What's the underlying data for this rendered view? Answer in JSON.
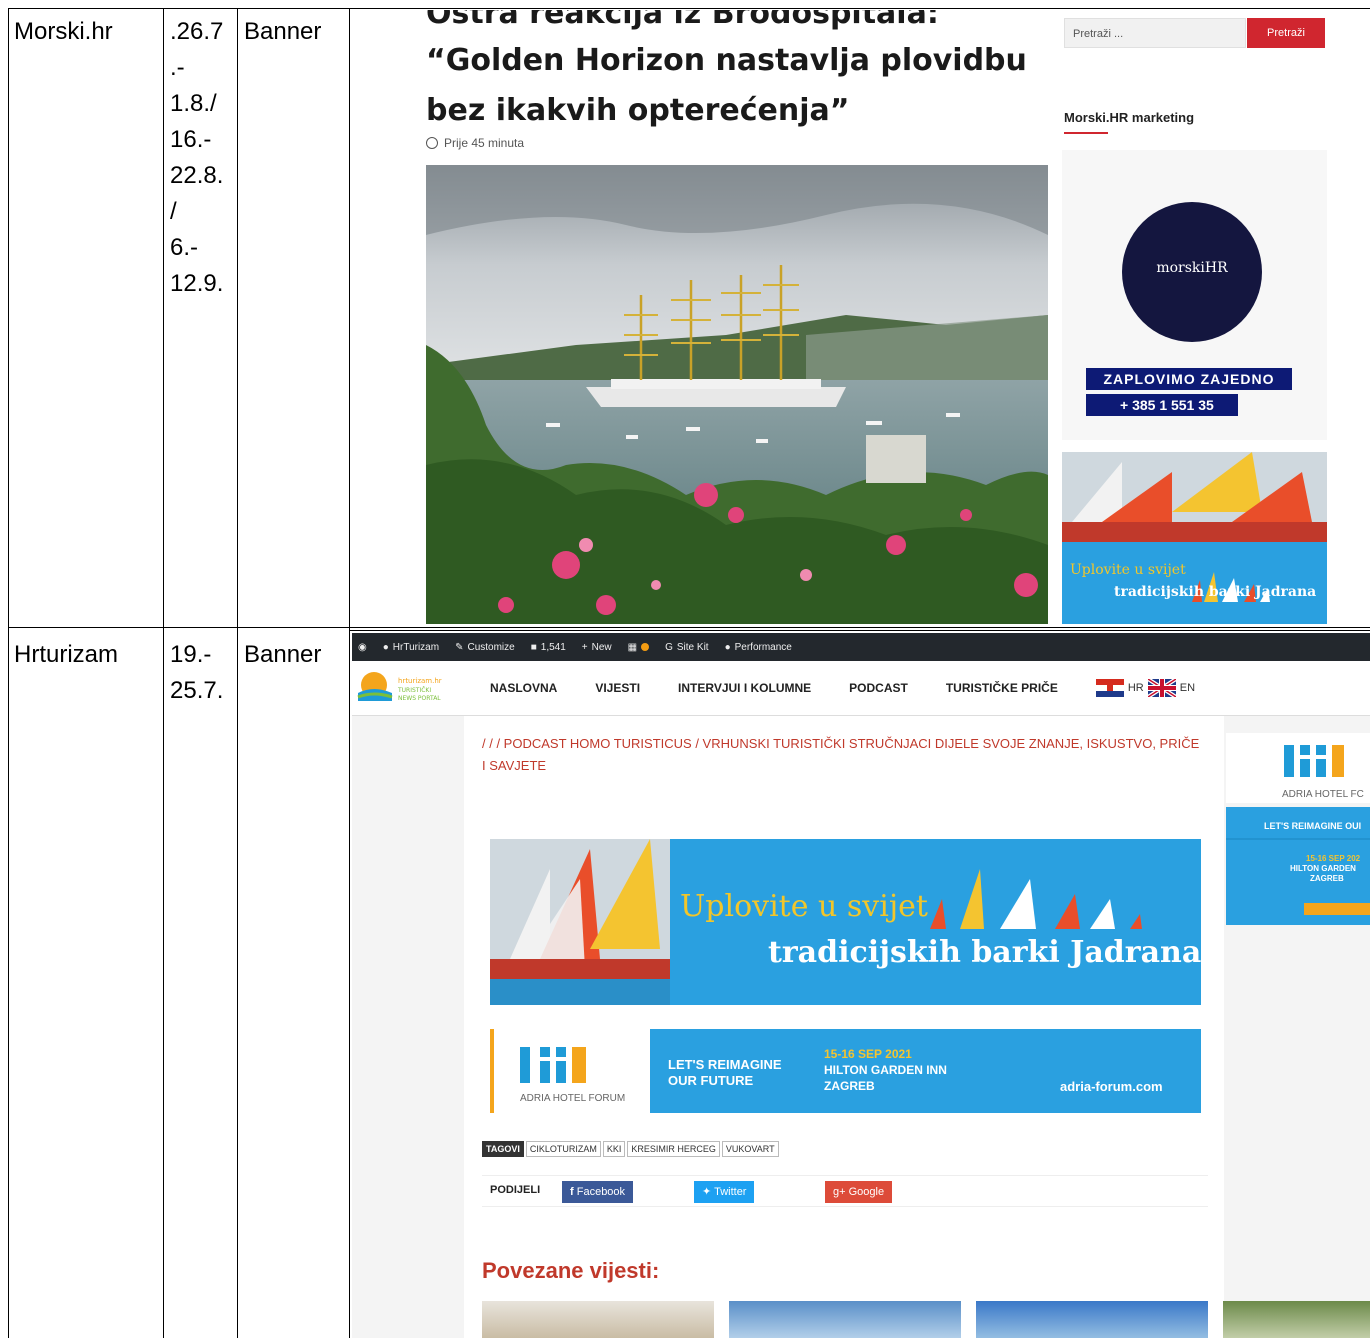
{
  "table": {
    "rows": [
      {
        "site": "Morski.hr",
        "dates": ".26.7\n.-\n1.8./\n16.-\n22.8.\n/\n6.-\n12.9.",
        "type": "Banner"
      },
      {
        "site": "Hrturizam",
        "dates": "19.-\n25.7.",
        "type": "Banner"
      }
    ]
  },
  "morski": {
    "headline_cut": "Ostra reakcija iz Brodospitala:",
    "headline": "“Golden Horizon nastavlja plovidbu bez ikakvih opterećenja”",
    "time_ago": "Prije 45 minuta",
    "search_placeholder": "Pretraži ...",
    "search_button": "Pretraži",
    "marketing_heading": "Morski.HR marketing",
    "logo_text": "morskiHR",
    "slogan": "ZAPLOVIMO ZAJEDNO",
    "phone": "+ 385 1 551 35",
    "ad_line1": "Uplovite u svijet",
    "ad_line2": "tradicijskih barki Jadrana"
  },
  "hrturizam": {
    "wp_bar": [
      "HrTurizam",
      "Customize",
      "1,541",
      "New",
      "Site Kit",
      "Performance"
    ],
    "logo_text": "hrturizam.hr TURISTIČKI NEWS PORTAL",
    "nav": [
      "NASLOVNA",
      "VIJESTI",
      "INTERVJUI I KOLUMNE",
      "PODCAST",
      "TURISTIČKE PRIČE"
    ],
    "lang_hr": "HR",
    "lang_en": "EN",
    "breadcrumb": "/ / / PODCAST HOMO TURISTICUS / VRHUNSKI TURISTIČKI STRUČNJACI DIJELE SVOJE ZNANJE, ISKUSTVO, PRIČE I SAVJETE",
    "ad_line1": "Uplovite u svijet",
    "ad_line2": "tradicijskih barki Jadrana",
    "ahf_name": "ADRIA HOTEL FORUM",
    "ahf_slogan1": "LET'S REIMAGINE",
    "ahf_slogan2": "OUR FUTURE",
    "ahf_date": "15-16 SEP 2021",
    "ahf_venue1": "HILTON GARDEN INN",
    "ahf_venue2": "ZAGREB",
    "ahf_url": "adria-forum.com",
    "side_name": "ADRIA HOTEL FC",
    "side_slogan": "LET'S REIMAGINE OUI",
    "side_date": "15-16 SEP 202",
    "side_venue1": "HILTON GARDEN",
    "side_venue2": "ZAGREB",
    "tags_label": "TAGOVI",
    "tags": [
      "CIKLOTURIZAM",
      "KKI",
      "KRESIMIR HERCEG",
      "VUKOVART"
    ],
    "share_label": "PODIJELI",
    "share": [
      "Facebook",
      "Twitter",
      "Google"
    ],
    "related": "Povezane vijesti:"
  },
  "colors": {
    "ad_blue": "#2aa0e0",
    "navy": "#14163f",
    "red": "#c0392b",
    "facebook": "#3b5998",
    "twitter": "#1da1f2",
    "google": "#dd4b39"
  }
}
